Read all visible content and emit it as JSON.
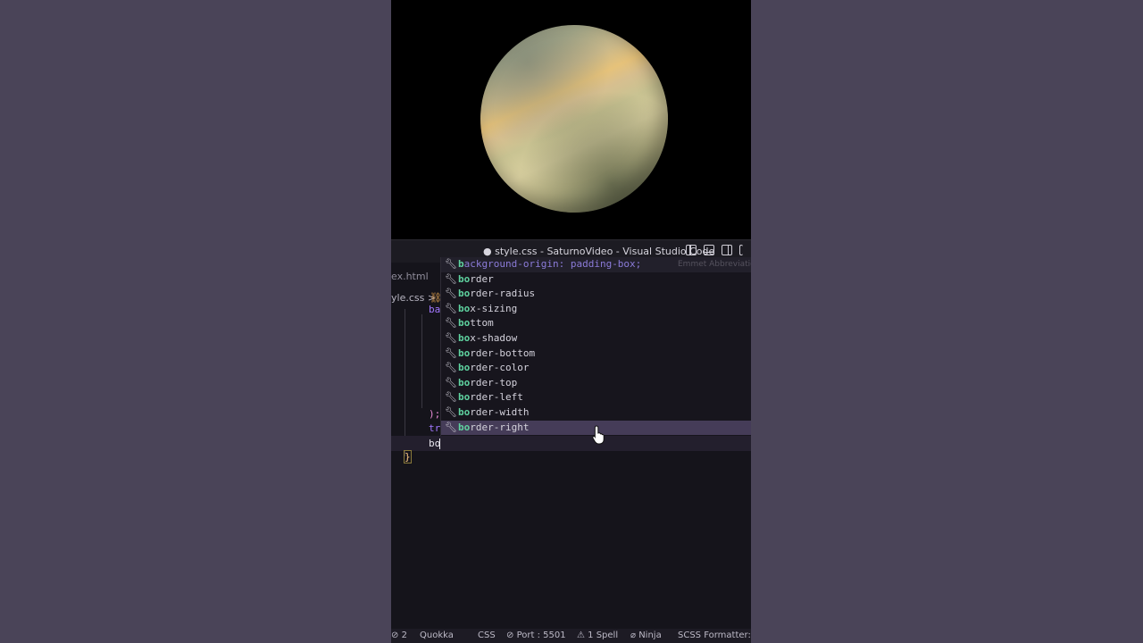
{
  "window": {
    "title": "● style.css - SaturnoVideo - Visual Studio Code"
  },
  "editor": {
    "tab_fragment": "ex.html",
    "breadcrumb_fragment": "yle.css >",
    "code_fragments": {
      "line1": "ba",
      "line2": ");",
      "line3": "tr",
      "line4": "bo",
      "brace": "}"
    }
  },
  "suggestions": [
    {
      "match": "b",
      "rest": "ackground-origin: padding-box;",
      "detail": "Emmet Abbreviation"
    },
    {
      "match": "bo",
      "rest": "rder"
    },
    {
      "match": "bo",
      "rest": "rder-radius"
    },
    {
      "match": "bo",
      "rest": "x-sizing"
    },
    {
      "match": "bo",
      "rest": "ttom"
    },
    {
      "match": "bo",
      "rest": "x-shadow"
    },
    {
      "match": "bo",
      "rest": "rder-bottom"
    },
    {
      "match": "bo",
      "rest": "rder-color"
    },
    {
      "match": "bo",
      "rest": "rder-top"
    },
    {
      "match": "bo",
      "rest": "rder-left"
    },
    {
      "match": "bo",
      "rest": "rder-width"
    },
    {
      "match": "bo",
      "rest": "rder-right"
    }
  ],
  "statusbar": {
    "problems": "2",
    "quokka": "Quokka",
    "language": "CSS",
    "port": "Port : 5501",
    "spell": "1 Spell",
    "ninja": "Ninja",
    "formatter": "SCSS Formatter: v"
  },
  "colors": {
    "backdrop": "#4a4458",
    "editor_bg": "#15141b",
    "match": "#5fd3a0",
    "selected_row": "#453c58",
    "keyword": "#a277ff"
  }
}
